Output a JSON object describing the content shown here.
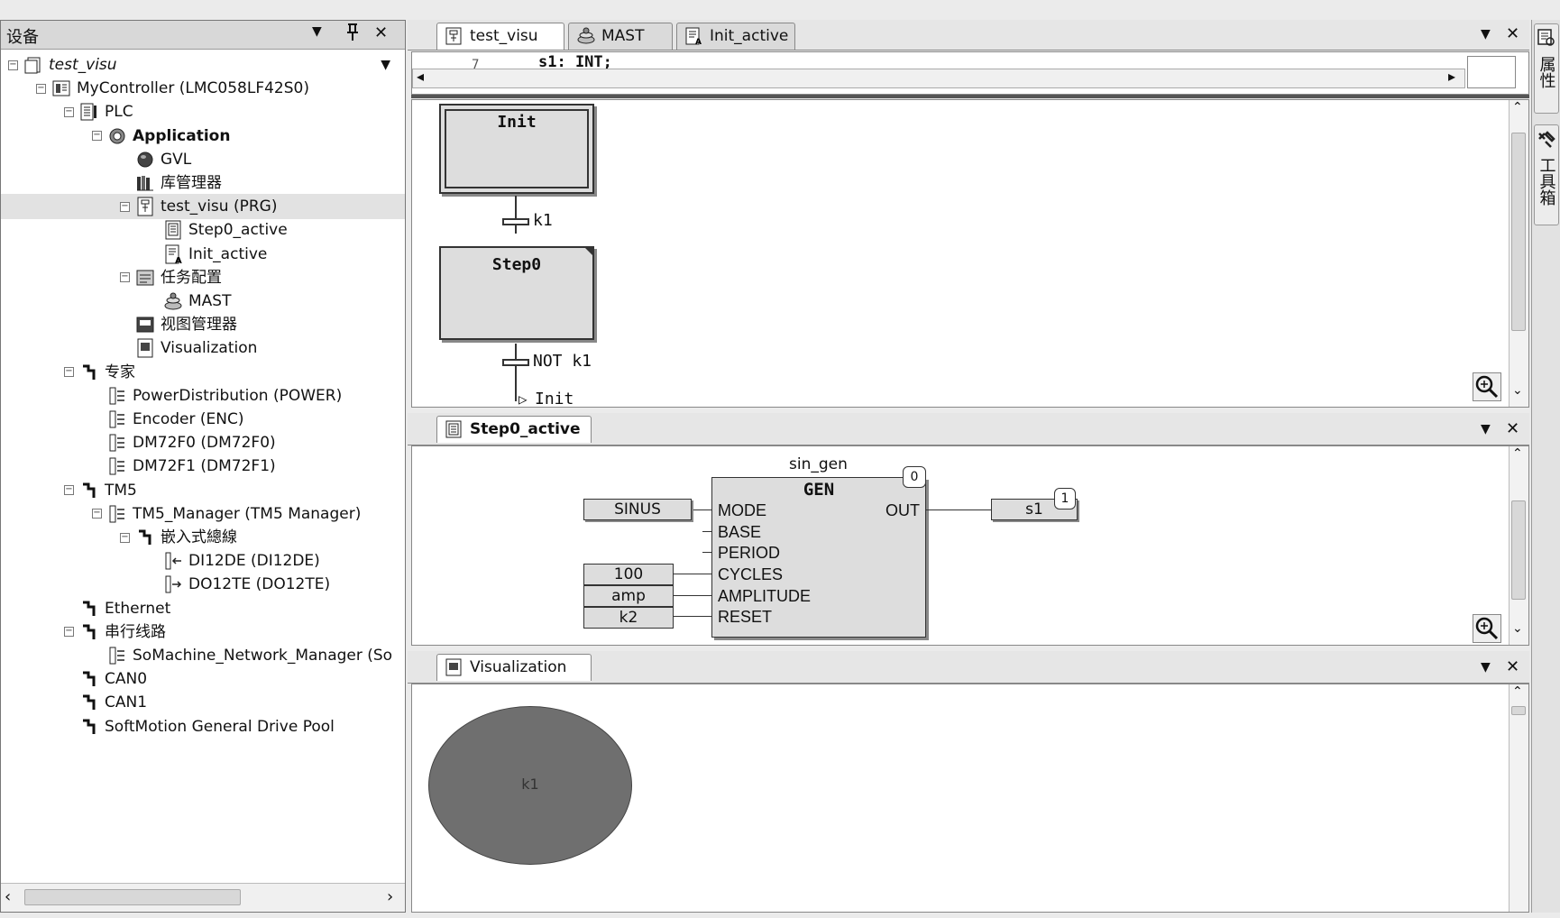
{
  "device_panel": {
    "title": "设备",
    "controls": {
      "dropdown": "▼",
      "pin": "ᵖ",
      "close": "✕"
    },
    "tree": [
      {
        "label": "test_visu",
        "style": "ital",
        "icon": "project-icon",
        "level": 0,
        "expander": "−",
        "dropdown": "▼"
      },
      {
        "label": "MyController (LMC058LF42S0)",
        "icon": "controller-icon",
        "level": 1,
        "expander": "−"
      },
      {
        "label": "PLC",
        "icon": "plc-icon",
        "level": 2,
        "expander": "−"
      },
      {
        "label": "Application",
        "style": "bold",
        "icon": "application-gear-icon",
        "level": 3,
        "expander": "−"
      },
      {
        "label": "GVL",
        "icon": "globe-icon",
        "level": 4
      },
      {
        "label": "库管理器",
        "icon": "library-icon",
        "level": 4
      },
      {
        "label": "test_visu (PRG)",
        "icon": "sfc-program-icon",
        "level": 4,
        "expander": "−",
        "selected": true
      },
      {
        "label": "Step0_active",
        "icon": "action-icon",
        "level": 5
      },
      {
        "label": "Init_active",
        "icon": "action-text-icon",
        "level": 5
      },
      {
        "label": "任务配置",
        "icon": "task-config-icon",
        "level": 4,
        "expander": "−"
      },
      {
        "label": "MAST",
        "icon": "task-icon",
        "level": 5
      },
      {
        "label": "视图管理器",
        "icon": "visu-manager-icon",
        "level": 4
      },
      {
        "label": "Visualization",
        "icon": "visualization-icon",
        "level": 4
      },
      {
        "label": "专家",
        "icon": "bus-icon",
        "level": 2,
        "expander": "−"
      },
      {
        "label": "PowerDistribution (POWER)",
        "icon": "module-icon",
        "level": 3
      },
      {
        "label": "Encoder (ENC)",
        "icon": "module-icon",
        "level": 3
      },
      {
        "label": "DM72F0 (DM72F0)",
        "icon": "module-icon",
        "level": 3
      },
      {
        "label": "DM72F1 (DM72F1)",
        "icon": "module-icon",
        "level": 3
      },
      {
        "label": "TM5",
        "icon": "bus-icon",
        "level": 2,
        "expander": "−"
      },
      {
        "label": "TM5_Manager (TM5 Manager)",
        "icon": "module-icon",
        "level": 3,
        "expander": "−"
      },
      {
        "label": "嵌入式總線",
        "icon": "bus-icon",
        "level": 4,
        "expander": "−"
      },
      {
        "label": "DI12DE (DI12DE)",
        "icon": "input-module-icon",
        "level": 5
      },
      {
        "label": "DO12TE (DO12TE)",
        "icon": "output-module-icon",
        "level": 5
      },
      {
        "label": "Ethernet",
        "icon": "bus-icon",
        "level": 2
      },
      {
        "label": "串行线路",
        "icon": "bus-icon",
        "level": 2,
        "expander": "−"
      },
      {
        "label": "SoMachine_Network_Manager (So",
        "icon": "module-icon",
        "level": 3
      },
      {
        "label": "CAN0",
        "icon": "bus-icon",
        "level": 2
      },
      {
        "label": "CAN1",
        "icon": "bus-icon",
        "level": 2
      },
      {
        "label": "SoftMotion General Drive Pool",
        "icon": "bus-icon",
        "level": 2
      }
    ]
  },
  "editor_tabs": [
    {
      "label": "test_visu",
      "icon": "sfc-program-icon",
      "active": true
    },
    {
      "label": "MAST",
      "icon": "task-icon",
      "active": false
    },
    {
      "label": "Init_active",
      "icon": "action-text-icon",
      "active": false
    }
  ],
  "editor_controls": {
    "dropdown": "▼",
    "close": "✕"
  },
  "declaration": {
    "line_number": "7",
    "code_fragment": "s1: INT;"
  },
  "sfc": {
    "steps": [
      "Init",
      "Step0"
    ],
    "transitions": [
      "k1",
      "NOT k1"
    ],
    "jump_target": "Init"
  },
  "step0_panel": {
    "tab_label": "Step0_active",
    "fbd": {
      "instance_name": "sin_gen",
      "block_type": "GEN",
      "block_order": "0",
      "inputs": [
        "MODE",
        "BASE",
        "PERIOD",
        "CYCLES",
        "AMPLITUDE",
        "RESET"
      ],
      "output": "OUT",
      "input_values": {
        "MODE": "SINUS",
        "CYCLES": "100",
        "AMPLITUDE": "amp",
        "RESET": "k2"
      },
      "output_var": "s1",
      "output_order": "1"
    }
  },
  "visualization_panel": {
    "tab_label": "Visualization",
    "ellipse_label": "k1"
  },
  "right_bar": {
    "properties_label": "属性",
    "toolbox_label": "工具箱"
  },
  "colors": {
    "ellipse_fill": "#6f6f6f",
    "block_fill": "#dddddd",
    "panel_bg": "#ffffff"
  }
}
